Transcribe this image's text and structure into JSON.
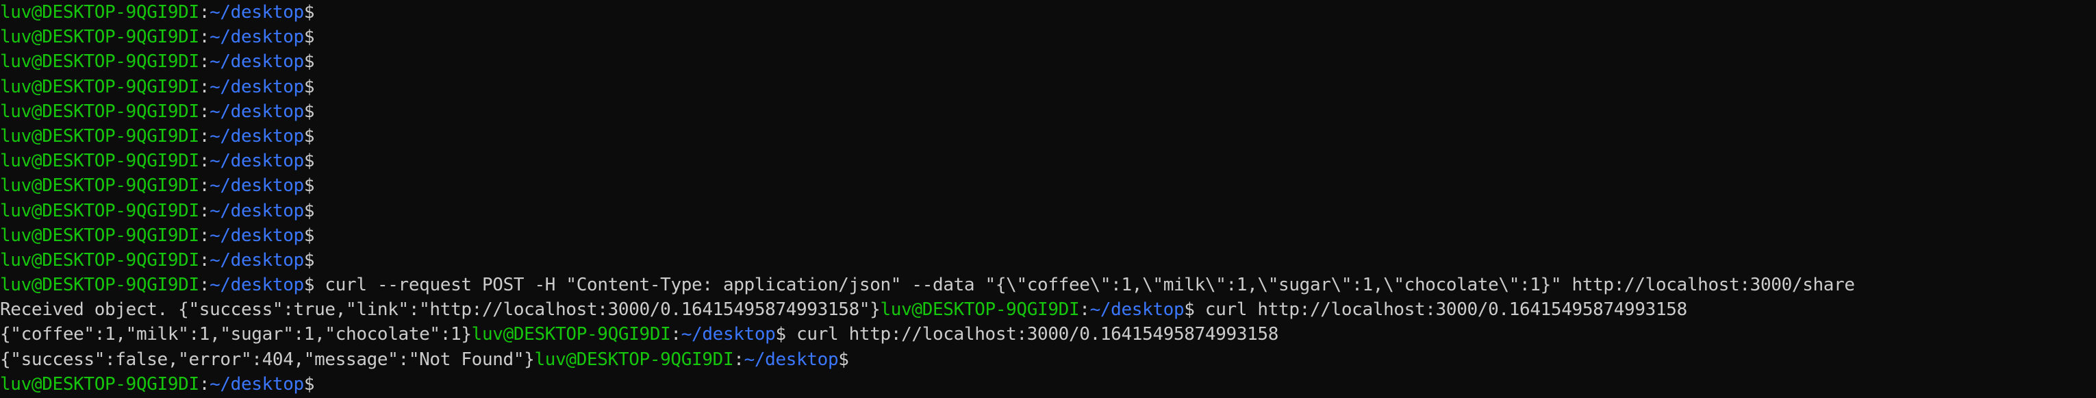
{
  "terminal": {
    "prompt": {
      "user_host": "luv@DESKTOP-9QGI9DI",
      "separator": ":",
      "path": "~/desktop",
      "symbol": "$"
    },
    "lines": [
      {
        "segments": []
      },
      {
        "segments": []
      },
      {
        "segments": []
      },
      {
        "segments": []
      },
      {
        "segments": []
      },
      {
        "segments": []
      },
      {
        "segments": []
      },
      {
        "segments": []
      },
      {
        "segments": []
      },
      {
        "segments": []
      },
      {
        "segments": []
      },
      {
        "command": " curl --request POST -H \"Content-Type: application/json\" --data \"{\\\"coffee\\\":1,\\\"milk\\\":1,\\\"sugar\\\":1,\\\"chocolate\\\":1}\" http://localhost:3000/share"
      },
      {
        "output": "Received object. {\"success\":true,\"link\":\"http://localhost:3000/0.16415495874993158\"}",
        "command": " curl http://localhost:3000/0.16415495874993158"
      },
      {
        "output": "{\"coffee\":1,\"milk\":1,\"sugar\":1,\"chocolate\":1}",
        "command": " curl http://localhost:3000/0.16415495874993158"
      },
      {
        "output": "{\"success\":false,\"error\":404,\"message\":\"Not Found\"}",
        "command": ""
      },
      {
        "command": ""
      }
    ]
  }
}
